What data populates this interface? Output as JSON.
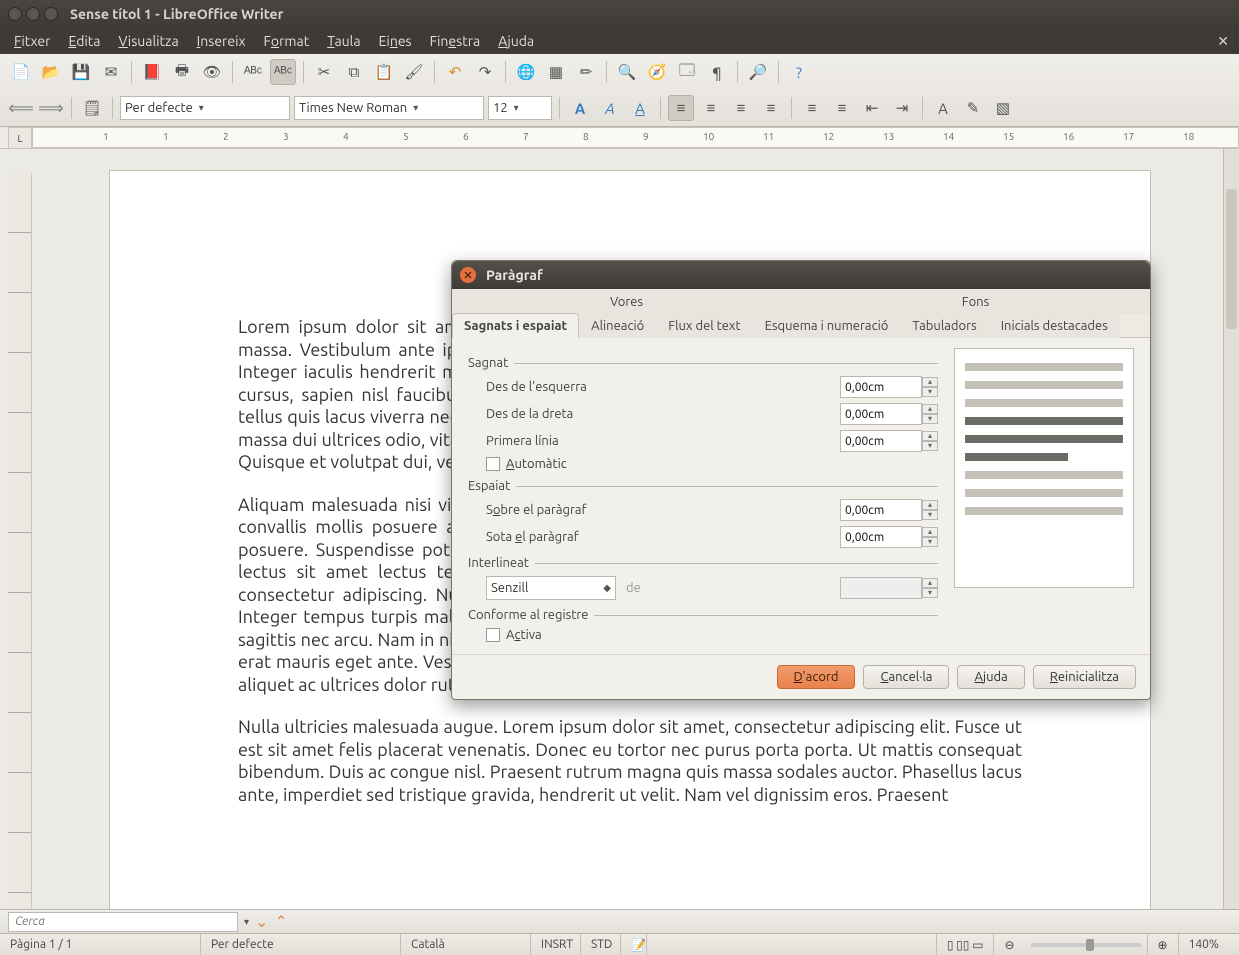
{
  "window": {
    "title": "Sense títol 1 - LibreOffice Writer"
  },
  "menubar": [
    "Fitxer",
    "Edita",
    "Visualitza",
    "Insereix",
    "Format",
    "Taula",
    "Eines",
    "Finestra",
    "Ajuda"
  ],
  "toolbar2": {
    "style": "Per defecte",
    "font": "Times New Roman",
    "size": "12"
  },
  "ruler_marks": [
    -1,
    1,
    2,
    3,
    4,
    5,
    6,
    7,
    8,
    9,
    10,
    11,
    12,
    13,
    14,
    15,
    16,
    17,
    18
  ],
  "document": {
    "p1": "Lorem ipsum dolor sit amet, consectetur adipiscing elit. Vivamus pulvinar dolor ullamcorper massa. Vestibulum ante ipsum primis in faucibus orci luctus et ultrices posuere cubilia Curae. Integer iaculis hendrerit magna, non commodo massa sodales vel. Duis sit amet dui vel sapien cursus, sapien nisl faucibus nisl, sed rhoncus lectus. Integer condimentum in magna ornare a tellus quis lacus viverra nec tincidunt mi dignissim. Vestibulum pharetra, risus a gravida venenatis massa dui ultrices odio, vitae facilisis odio odio eget nec. Sed et dignissim neque. Nullam ac ligula. Quisque et volutpat dui, vestibulum rhoncus rutrum lorem.",
    "p2": "Aliquam malesuada nisi vitae commodo suscipit. Proin egestas, mi nec fermentum fringilla, mi convallis mollis posuere arcu. Sed erat tellus, vehicula sit amet egestas id, quis id tincidunt posuere. Suspendisse potenti. Vivamus vitae leo at justo rutrum dignissum eget lacus. Donec lectus sit amet lectus tempor, et commodo magna fringilla. Lorem ipsum dolor sit amet, consectetur adipiscing. Nulla vel velit mauris. Morbi malesuada, vitae fugiat rutrum posuere. Integer tempus turpis malesuada id at eros sagittis. In sagittis. Donec sit amet est aliquam vel, sagittis nec arcu. Nam in nisl, Aenean nisl lacus, cursus sed ut magna erat. Sed volutpat adipiscing erat mauris eget ante. Vestibulum lectus dolor, mollit vitae nisl vitae, mattis ultrices lectus ligula, aliquet ac ultrices dolor rutrum.",
    "p3": "Nulla ultricies malesuada augue. Lorem ipsum dolor sit amet, consectetur adipiscing elit. Fusce ut est sit amet felis placerat venenatis. Donec eu tortor nec purus porta porta. Ut mattis consequat bibendum. Duis ac congue nisl. Praesent rutrum magna quis massa sodales auctor. Phasellus lacus ante, imperdiet sed tristique gravida, hendrerit ut velit. Nam vel dignissim eros. Praesent"
  },
  "findbar": {
    "placeholder": "Cerca"
  },
  "statusbar": {
    "page": "Pàgina  1 / 1",
    "style": "Per defecte",
    "lang": "Català",
    "insert": "INSRT",
    "std": "STD",
    "zoom": "140%"
  },
  "dialog": {
    "title": "Paràgraf",
    "tabs_top": [
      "Vores",
      "Fons"
    ],
    "tabs": [
      "Sagnats i espaiat",
      "Alineació",
      "Flux del text",
      "Esquema i numeració",
      "Tabuladors",
      "Inicials destacades"
    ],
    "active_tab": "Sagnats i espaiat",
    "groups": {
      "sagnat": {
        "title": "Sagnat",
        "left_label": "Des de l'esquerra",
        "left_value": "0,00cm",
        "right_label": "Des de la dreta",
        "right_value": "0,00cm",
        "first_label": "Primera línia",
        "first_value": "0,00cm",
        "auto_label": "Automàtic"
      },
      "espaiat": {
        "title": "Espaiat",
        "above_label": "Sobre el paràgraf",
        "above_value": "0,00cm",
        "below_label": "Sota el paràgraf",
        "below_value": "0,00cm"
      },
      "interlineat": {
        "title": "Interlineat",
        "value": "Senzill",
        "de_label": "de"
      },
      "registre": {
        "title": "Conforme al registre",
        "activa_label": "Activa"
      }
    },
    "buttons": {
      "ok": "D'acord",
      "cancel": "Cancel·la",
      "help": "Ajuda",
      "reset": "Reinicialitza"
    }
  }
}
